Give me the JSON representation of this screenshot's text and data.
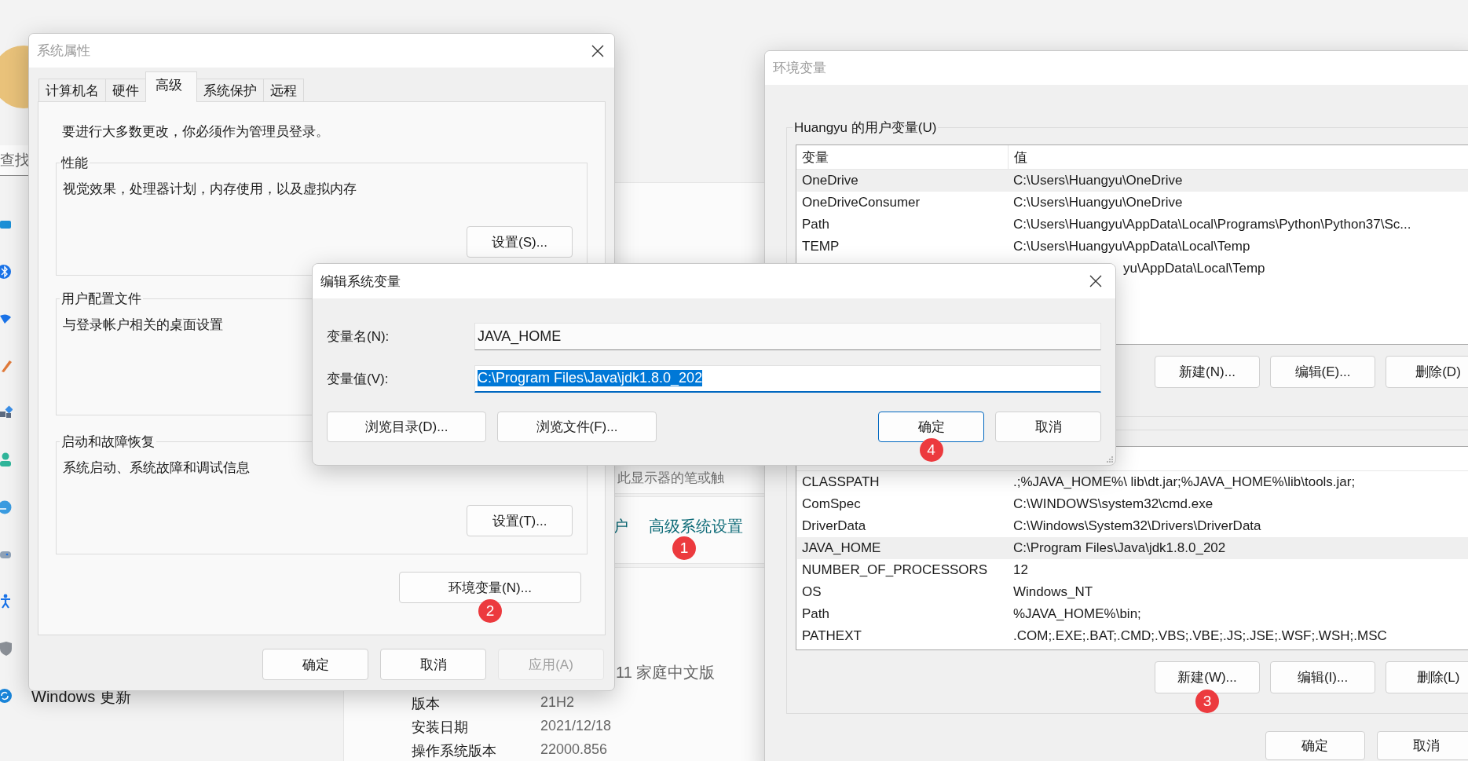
{
  "settings": {
    "search": {
      "placeholder": "查找"
    },
    "nav": [
      {
        "label": "Windows 更新"
      }
    ],
    "display_note": "此显示器的笔或触",
    "related_prefix": "户",
    "related_link": {
      "label": "高级系统设置",
      "badge": "1"
    },
    "edition": "11 家庭中文版",
    "specs": [
      {
        "label": "版本",
        "value": "21H2"
      },
      {
        "label": "安装日期",
        "value": "2021/12/18"
      },
      {
        "label": "操作系统版本",
        "value": "22000.856"
      }
    ]
  },
  "system_properties": {
    "title": "系统属性",
    "tabs": [
      {
        "label": "计算机名",
        "selected": false
      },
      {
        "label": "硬件",
        "selected": false
      },
      {
        "label": "高级",
        "selected": true
      },
      {
        "label": "系统保护",
        "selected": false
      },
      {
        "label": "远程",
        "selected": false
      }
    ],
    "admin_note": "要进行大多数更改，你必须作为管理员登录。",
    "groups": [
      {
        "title": "性能",
        "description": "视觉效果，处理器计划，内存使用，以及虚拟内存",
        "button": "设置(S)..."
      },
      {
        "title": "用户配置文件",
        "description": "与登录帐户相关的桌面设置"
      },
      {
        "title": "启动和故障恢复",
        "description": "系统启动、系统故障和调试信息",
        "button": "设置(T)..."
      }
    ],
    "env_button": {
      "label": "环境变量(N)...",
      "badge": "2"
    },
    "buttons": [
      {
        "label": "确定",
        "disabled": false
      },
      {
        "label": "取消",
        "disabled": false
      },
      {
        "label": "应用(A)",
        "disabled": true
      }
    ]
  },
  "environment_variables": {
    "title": "环境变量",
    "user_group": "Huangyu 的用户变量(U)",
    "user_table": {
      "columns": [
        "变量",
        "值"
      ],
      "rows": [
        {
          "name": "OneDrive",
          "value": "C:\\Users\\Huangyu\\OneDrive",
          "selected": true
        },
        {
          "name": "OneDriveConsumer",
          "value": "C:\\Users\\Huangyu\\OneDrive",
          "selected": false
        },
        {
          "name": "Path",
          "value": "C:\\Users\\Huangyu\\AppData\\Local\\Programs\\Python\\Python37\\Sc...",
          "selected": false
        },
        {
          "name": "TEMP",
          "value": "C:\\Users\\Huangyu\\AppData\\Local\\Temp",
          "selected": false
        },
        {
          "kind": "partial",
          "value": "yu\\AppData\\Local\\Temp",
          "selected": false
        }
      ]
    },
    "user_buttons": [
      {
        "label": "新建(N)..."
      },
      {
        "label": "编辑(E)..."
      },
      {
        "label": "删除(D)"
      }
    ],
    "system_table": {
      "rows": [
        {
          "name": "CLASSPATH",
          "value": ".;%JAVA_HOME%\\  lib\\dt.jar;%JAVA_HOME%\\lib\\tools.jar;",
          "selected": false
        },
        {
          "name": "ComSpec",
          "value": "C:\\WINDOWS\\system32\\cmd.exe",
          "selected": false
        },
        {
          "name": "DriverData",
          "value": "C:\\Windows\\System32\\Drivers\\DriverData",
          "selected": false
        },
        {
          "name": "JAVA_HOME",
          "value": "C:\\Program Files\\Java\\jdk1.8.0_202",
          "selected": true
        },
        {
          "name": "NUMBER_OF_PROCESSORS",
          "value": "12",
          "selected": false
        },
        {
          "name": "OS",
          "value": "Windows_NT",
          "selected": false
        },
        {
          "name": "Path",
          "value": "%JAVA_HOME%\\bin;",
          "selected": false
        },
        {
          "name": "PATHEXT",
          "value": ".COM;.EXE;.BAT;.CMD;.VBS;.VBE;.JS;.JSE;.WSF;.WSH;.MSC",
          "selected": false
        }
      ]
    },
    "system_buttons": [
      {
        "label": "新建(W)...",
        "badge": "3"
      },
      {
        "label": "编辑(I)..."
      },
      {
        "label": "删除(L)"
      }
    ],
    "buttons": [
      {
        "label": "确定"
      },
      {
        "label": "取消"
      }
    ]
  },
  "edit_dialog": {
    "title": "编辑系统变量",
    "fields": [
      {
        "label": "变量名(N):",
        "value": "JAVA_HOME",
        "selected": false
      },
      {
        "label": "变量值(V):",
        "value": "C:\\Program Files\\Java\\jdk1.8.0_202",
        "selected": true
      }
    ],
    "browse_buttons": [
      {
        "label": "浏览目录(D)..."
      },
      {
        "label": "浏览文件(F)..."
      }
    ],
    "buttons": [
      {
        "label": "确定",
        "default": true,
        "badge": "4"
      },
      {
        "label": "取消",
        "default": false
      }
    ]
  }
}
